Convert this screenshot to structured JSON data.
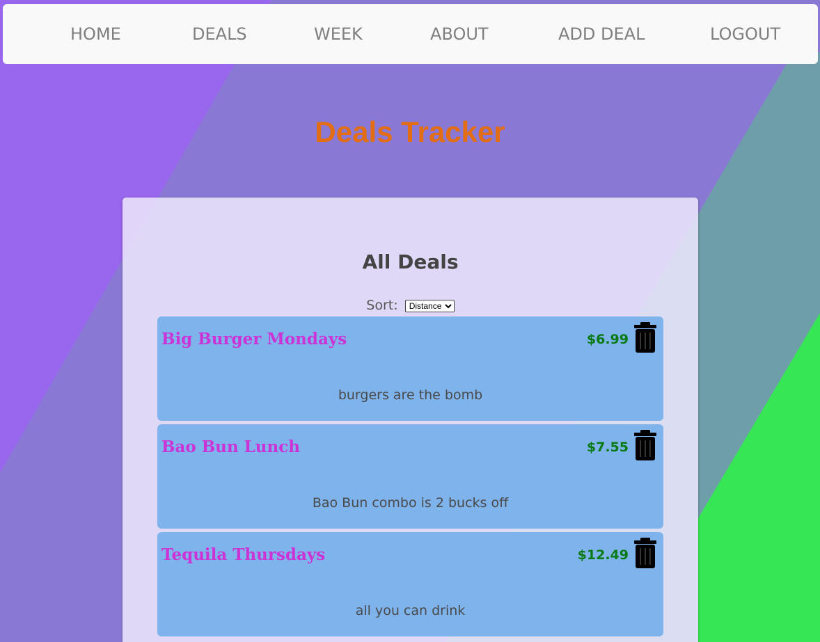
{
  "nav": {
    "home": "HOME",
    "deals": "DEALS",
    "week": "WEEK",
    "about": "ABOUT",
    "add_deal": "ADD DEAL",
    "logout": "LOGOUT"
  },
  "page": {
    "title": "Deals Tracker"
  },
  "main": {
    "heading": "All Deals",
    "sort_label": "Sort:",
    "sort_selected": "Distance",
    "deals": [
      {
        "name": "Big Burger Mondays",
        "price": "$6.99",
        "description": "burgers are the bomb"
      },
      {
        "name": "Bao Bun Lunch",
        "price": "$7.55",
        "description": "Bao Bun combo is 2 bucks off"
      },
      {
        "name": "Tequila Thursdays",
        "price": "$12.49",
        "description": "all you can drink"
      }
    ]
  },
  "icons": {
    "delete": "trash-icon"
  },
  "colors": {
    "title": "#e36d13",
    "deal_name": "#cc33d6",
    "price": "#0a7a14",
    "card": "#7fb3eb",
    "bg_purple": "#9966ee",
    "bg_green": "#37e655"
  }
}
